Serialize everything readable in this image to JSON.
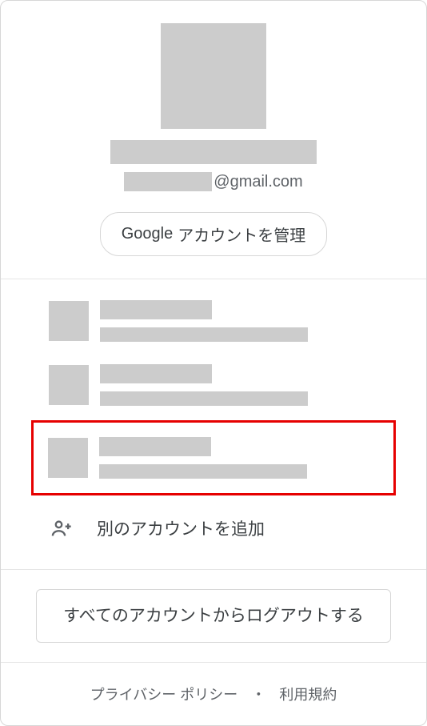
{
  "profile": {
    "email_domain": "@gmail.com"
  },
  "manage": {
    "brand": "Google",
    "label": "アカウントを管理"
  },
  "add_account": {
    "label": "別のアカウントを追加"
  },
  "signout": {
    "label": "すべてのアカウントからログアウトする"
  },
  "footer": {
    "privacy": "プライバシー ポリシー",
    "separator": "・",
    "terms": "利用規約"
  }
}
